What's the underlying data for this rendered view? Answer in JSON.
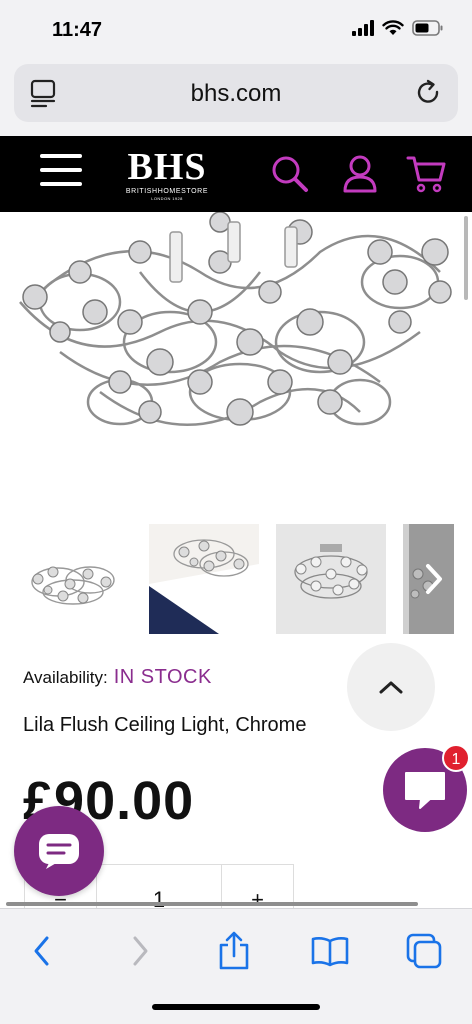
{
  "status_bar": {
    "time": "11:47"
  },
  "browser": {
    "url": "bhs.com"
  },
  "site_header": {
    "logo_text": "BHS",
    "logo_subtitle": "BRITISHHOMESTORE",
    "logo_tagline": "LONDON 1928",
    "icon_color": "#c33bbf"
  },
  "product": {
    "availability_label": "Availability:",
    "availability_value": "IN STOCK",
    "title": "Lila Flush Ceiling Light, Chrome",
    "price": "£90.00",
    "quantity": "1",
    "qty_minus": "−",
    "qty_plus": "+"
  },
  "chat": {
    "badge_count": "1",
    "color": "#7d2a82"
  },
  "colors": {
    "accent": "#8a2d8e",
    "toolbar_blue": "#1a73e8",
    "badge_red": "#e0202e"
  }
}
